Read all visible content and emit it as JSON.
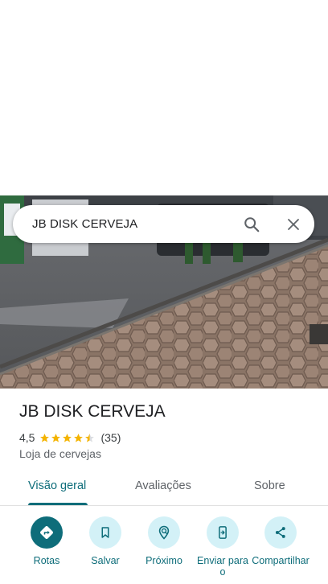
{
  "search": {
    "query": "JB DISK CERVEJA",
    "search_icon": "search-icon",
    "close_icon": "close-icon"
  },
  "place": {
    "name": "JB DISK CERVEJA",
    "rating": "4,5",
    "rating_value": 4.5,
    "review_count": "(35)",
    "category": "Loja de cervejas"
  },
  "tabs": [
    {
      "label": "Visão geral",
      "active": true
    },
    {
      "label": "Avaliações",
      "active": false
    },
    {
      "label": "Sobre",
      "active": false
    }
  ],
  "actions": [
    {
      "label": "Rotas",
      "icon": "directions-icon"
    },
    {
      "label": "Salvar",
      "icon": "bookmark-icon"
    },
    {
      "label": "Próximo",
      "icon": "nearby-icon"
    },
    {
      "label": "Enviar para o",
      "icon": "send-to-phone-icon"
    },
    {
      "label": "Compartilhar",
      "icon": "share-icon"
    }
  ],
  "colors": {
    "accent": "#0e6d7a",
    "action_bg": "#d3f1f7",
    "star": "#f4b400"
  }
}
